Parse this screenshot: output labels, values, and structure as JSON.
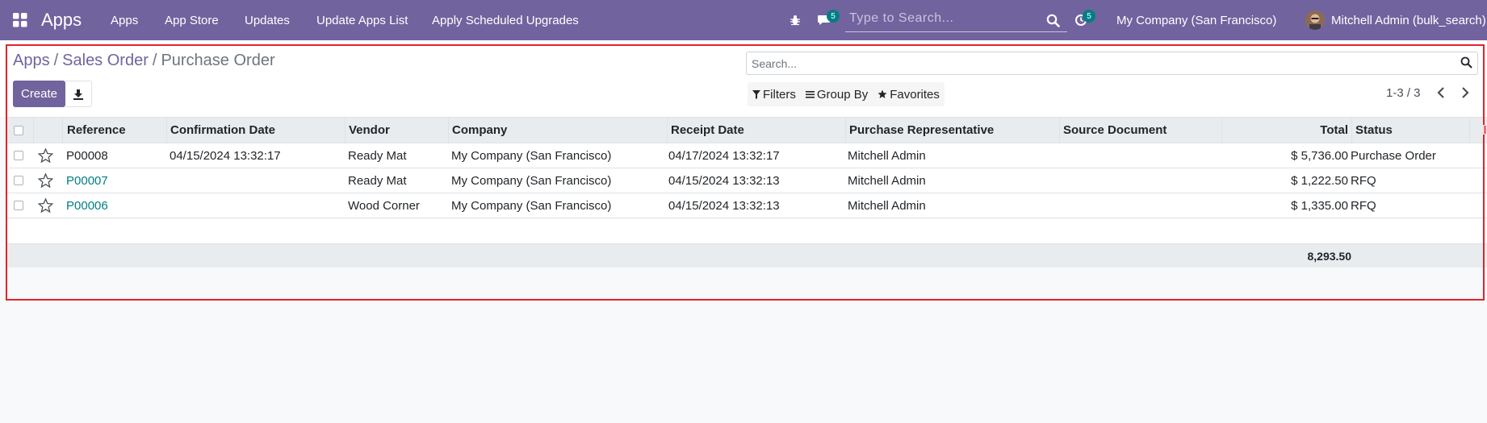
{
  "navbar": {
    "brand": "Apps",
    "menu": [
      "Apps",
      "App Store",
      "Updates",
      "Update Apps List",
      "Apply Scheduled Upgrades"
    ],
    "messages_badge": "5",
    "activity_badge": "5",
    "search_placeholder": "Type to Search...",
    "company": "My Company (San Francisco)",
    "user": "Mitchell Admin (bulk_search)"
  },
  "breadcrumb": {
    "items": [
      "Apps",
      "Sales Order"
    ],
    "current": "Purchase Order",
    "separator": "/"
  },
  "actions": {
    "create_label": "Create"
  },
  "search": {
    "placeholder": "Search..."
  },
  "filters": {
    "filters_label": "Filters",
    "group_by_label": "Group By",
    "favorites_label": "Favorites"
  },
  "pager": {
    "value": "1-3 / 3"
  },
  "table": {
    "columns": [
      "Reference",
      "Confirmation Date",
      "Vendor",
      "Company",
      "Receipt Date",
      "Purchase Representative",
      "Source Document",
      "Total",
      "Status"
    ],
    "rows": [
      {
        "reference": "P00008",
        "confirmation_date": "04/15/2024 13:32:17",
        "vendor": "Ready Mat",
        "company": "My Company (San Francisco)",
        "receipt_date": "04/17/2024 13:32:17",
        "representative": "Mitchell Admin",
        "source_document": "",
        "total": "$ 5,736.00",
        "status": "Purchase Order"
      },
      {
        "reference": "P00007",
        "confirmation_date": "",
        "vendor": "Ready Mat",
        "company": "My Company (San Francisco)",
        "receipt_date": "04/15/2024 13:32:13",
        "representative": "Mitchell Admin",
        "source_document": "",
        "total": "$ 1,222.50",
        "status": "RFQ"
      },
      {
        "reference": "P00006",
        "confirmation_date": "",
        "vendor": "Wood Corner",
        "company": "My Company (San Francisco)",
        "receipt_date": "04/15/2024 13:32:13",
        "representative": "Mitchell Admin",
        "source_document": "",
        "total": "$ 1,335.00",
        "status": "RFQ"
      }
    ],
    "grand_total": "8,293.50"
  },
  "colors": {
    "brand": "#71639e",
    "link": "#017e84",
    "highlight": "#e2232a"
  }
}
